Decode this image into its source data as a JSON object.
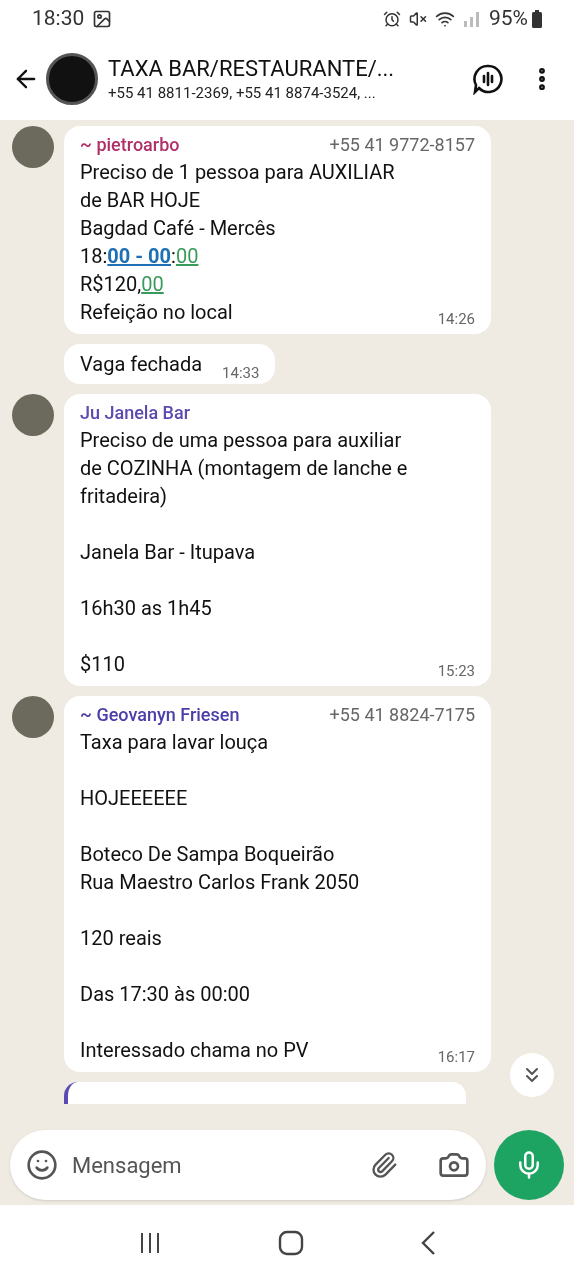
{
  "status_bar": {
    "time": "18:30",
    "battery": "95%"
  },
  "header": {
    "title": "TAXA BAR/RESTAURANTE/...",
    "subtitle": "+55 41 8811-2369, +55 41 8874-3524, ..."
  },
  "messages": [
    {
      "sender": "~ pietroarbo",
      "color": "#b0306a",
      "phone": "+55 41 9772-8157",
      "time": "14:26",
      "paragraphs": [
        [
          [
            {
              "kind": "text",
              "text": "Preciso de 1 pessoa para AUXILIAR"
            }
          ],
          [
            {
              "kind": "text",
              "text": "de BAR HOJE"
            }
          ],
          [
            {
              "kind": "text",
              "text": "Bagdad Café - Mercês"
            }
          ],
          [
            {
              "kind": "text",
              "text": "18:"
            },
            {
              "kind": "link",
              "text": "00 - 00"
            },
            {
              "kind": "text",
              "text": ":"
            },
            {
              "kind": "number",
              "text": "00"
            }
          ],
          [
            {
              "kind": "text",
              "text": "R$120,"
            },
            {
              "kind": "number",
              "text": "00"
            }
          ],
          [
            {
              "kind": "text",
              "text": "Refeição no local"
            }
          ]
        ]
      ]
    },
    {
      "time": "14:33",
      "paragraphs": [
        [
          [
            {
              "kind": "text",
              "text": "Vaga fechada"
            }
          ]
        ]
      ]
    },
    {
      "sender": "Ju Janela Bar",
      "color": "#5a4bb0",
      "time": "15:23",
      "paragraphs": [
        [
          [
            {
              "kind": "text",
              "text": "Preciso de uma pessoa para auxiliar"
            }
          ],
          [
            {
              "kind": "text",
              "text": "de COZINHA (montagem de lanche e"
            }
          ],
          [
            {
              "kind": "text",
              "text": "fritadeira)"
            }
          ]
        ],
        [
          [
            {
              "kind": "text",
              "text": "Janela Bar - Itupava"
            }
          ]
        ],
        [
          [
            {
              "kind": "text",
              "text": "16h30 as 1h45"
            }
          ]
        ],
        [
          [
            {
              "kind": "text",
              "text": "$110"
            }
          ]
        ]
      ]
    },
    {
      "sender": "~ Geovanyn Friesen",
      "color": "#4a3fa8",
      "phone": "+55 41 8824-7175",
      "time": "16:17",
      "paragraphs": [
        [
          [
            {
              "kind": "text",
              "text": "Taxa para lavar louça"
            }
          ]
        ],
        [
          [
            {
              "kind": "text",
              "text": "HOJEEEEEE"
            }
          ]
        ],
        [
          [
            {
              "kind": "text",
              "text": "Boteco De Sampa Boqueirão"
            }
          ],
          [
            {
              "kind": "text",
              "text": "Rua Maestro Carlos Frank 2050"
            }
          ]
        ],
        [
          [
            {
              "kind": "text",
              "text": "120 reais"
            }
          ]
        ],
        [
          [
            {
              "kind": "text",
              "text": "Das 17:30 às 00:00"
            }
          ]
        ],
        [
          [
            {
              "kind": "text",
              "text": "Interessado chama no PV"
            }
          ]
        ]
      ]
    }
  ],
  "composer": {
    "placeholder": "Mensagem"
  }
}
